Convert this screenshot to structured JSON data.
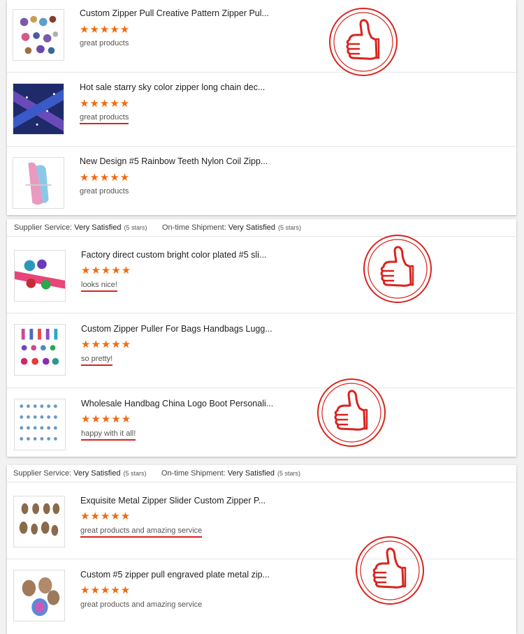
{
  "section1": {
    "items": [
      {
        "title": "Custom Zipper Pull Creative Pattern Zipper Pul...",
        "stars": "★★★★★",
        "comment": "great products"
      },
      {
        "title": "Hot sale starry sky color zipper long chain dec...",
        "stars": "★★★★★",
        "comment": "great products"
      },
      {
        "title": "New Design #5 Rainbow Teeth Nylon Coil Zipp...",
        "stars": "★★★★★",
        "comment": "great products"
      }
    ]
  },
  "section2": {
    "service": {
      "supplier_label": "Supplier Service:",
      "supplier_value": "Very Satisfied",
      "supplier_stars": "(5 stars)",
      "shipment_label": "On-time Shipment:",
      "shipment_value": "Very Satisfied",
      "shipment_stars": "(5 stars)"
    },
    "items": [
      {
        "title": "Factory direct custom bright color plated #5 sli...",
        "stars": "★★★★★",
        "comment": "looks nice!"
      },
      {
        "title": "Custom Zipper Puller For Bags Handbags Lugg...",
        "stars": "★★★★★",
        "comment": "so pretty!"
      },
      {
        "title": "Wholesale Handbag China Logo Boot Personali...",
        "stars": "★★★★★",
        "comment": "happy with it all!"
      }
    ]
  },
  "section3": {
    "service": {
      "supplier_label": "Supplier Service:",
      "supplier_value": "Very Satisfied",
      "supplier_stars": "(5 stars)",
      "shipment_label": "On-time Shipment:",
      "shipment_value": "Very Satisfied",
      "shipment_stars": "(5 stars)"
    },
    "items": [
      {
        "title": "Exquisite Metal Zipper Slider Custom Zipper P...",
        "stars": "★★★★★",
        "comment": "great products and amazing service"
      },
      {
        "title": "Custom #5 zipper pull engraved plate metal zip...",
        "stars": "★★★★★",
        "comment": "great products and amazing service"
      }
    ]
  },
  "colors": {
    "star": "#f26a10",
    "stamp": "#d9231d",
    "underline": "#d9231d"
  },
  "icons": {
    "stamp": "thumbs-up-stamp-icon",
    "star": "star-icon"
  }
}
